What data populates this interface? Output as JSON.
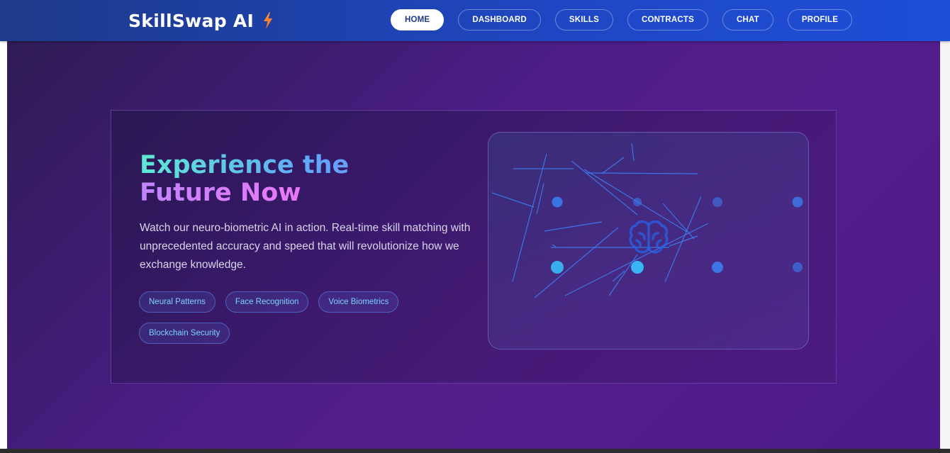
{
  "brand": {
    "name": "SkillSwap AI",
    "icon": "lightning-bolt-icon",
    "icon_color": "#f97316"
  },
  "nav": {
    "items": [
      {
        "label": "HOME",
        "active": true
      },
      {
        "label": "DASHBOARD",
        "active": false
      },
      {
        "label": "SKILLS",
        "active": false
      },
      {
        "label": "CONTRACTS",
        "active": false
      },
      {
        "label": "CHAT",
        "active": false
      },
      {
        "label": "PROFILE",
        "active": false
      }
    ]
  },
  "hero": {
    "title_line1": "Experience the",
    "title_line2": "Future Now",
    "description": "Watch our neuro-biometric AI in action. Real-time skill matching with unprecedented accuracy and speed that will revolutionize how we exchange knowledge.",
    "tags": [
      "Neural Patterns",
      "Face Recognition",
      "Voice Biometrics",
      "Blockchain Security"
    ]
  },
  "visualization": {
    "icon": "brain-icon",
    "accent_color": "#3b82f6"
  },
  "colors": {
    "nav_bg": "#1e3a8a",
    "hero_bg": "#4a1d84",
    "tag_text": "#7dd3fc",
    "title_gradient_1": [
      "#5eead4",
      "#818cf8"
    ],
    "title_gradient_2": [
      "#c084fc",
      "#ec4899"
    ]
  }
}
